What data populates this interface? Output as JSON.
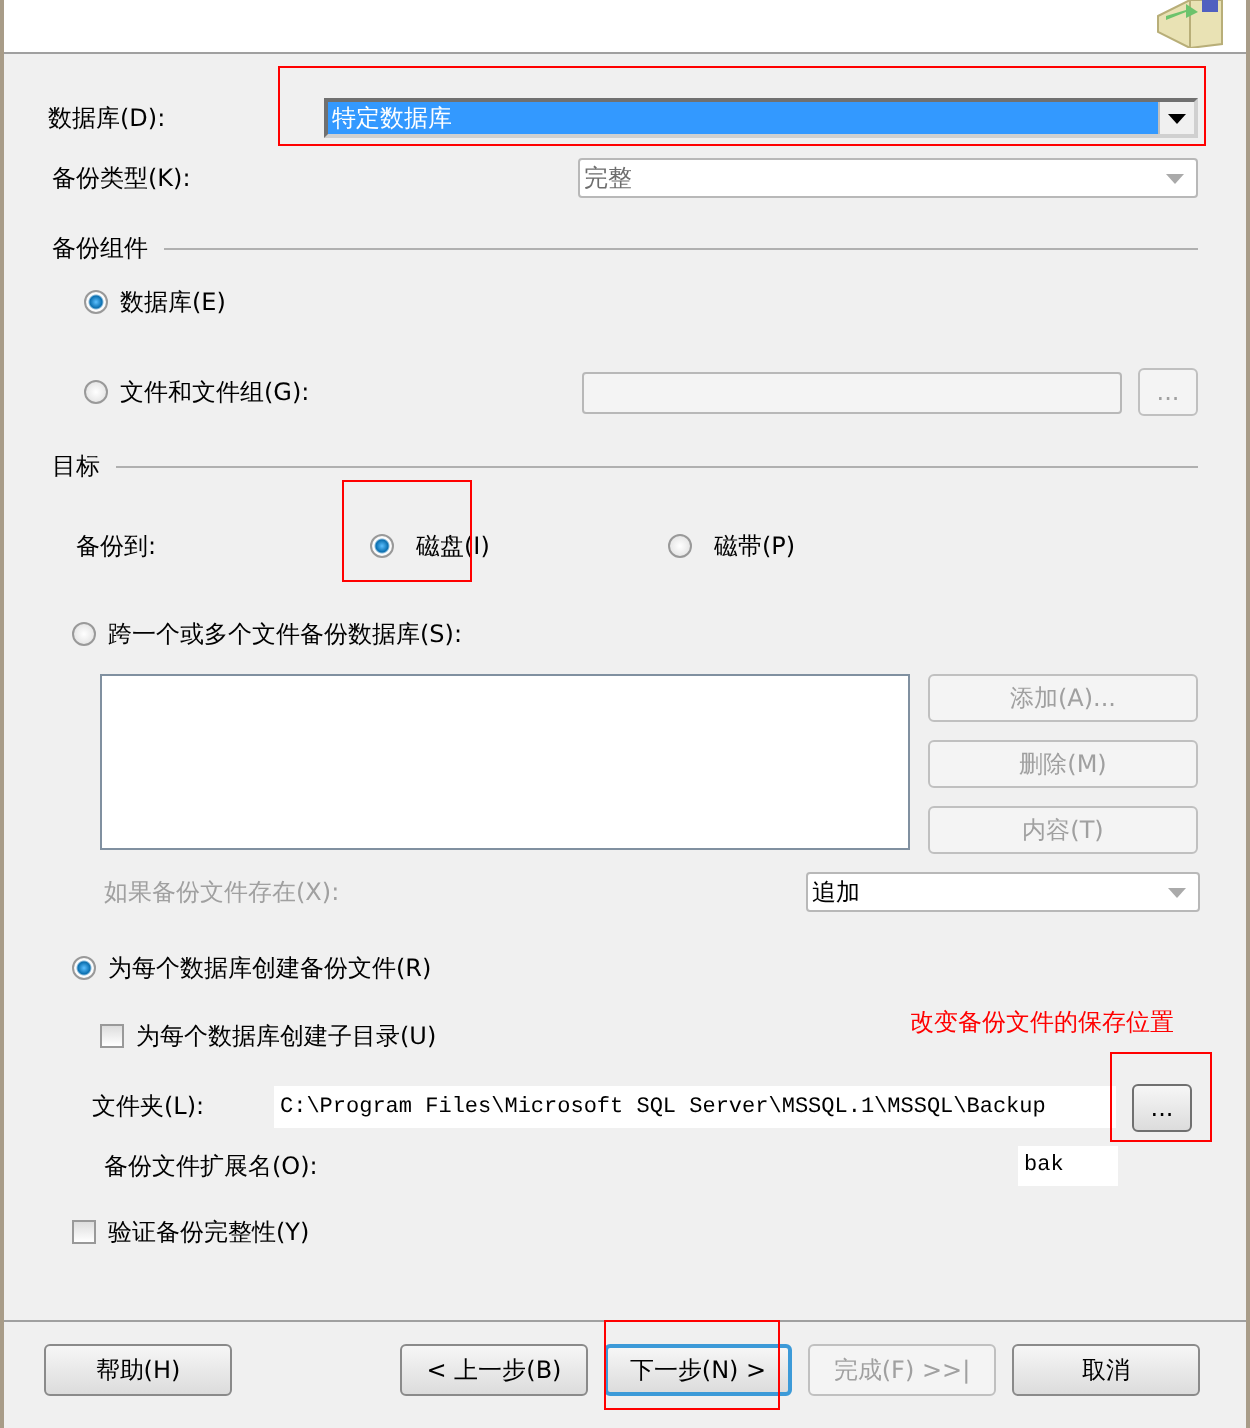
{
  "database": {
    "label": "数据库(D):",
    "value": "特定数据库",
    "highlighted": true
  },
  "backup_type": {
    "label": "备份类型(K):",
    "value": "完整",
    "disabled": true
  },
  "backup_component": {
    "title": "备份组件",
    "options": [
      {
        "label": "数据库(E)",
        "selected": true
      },
      {
        "label": "文件和文件组(G):",
        "selected": false
      }
    ],
    "browse_button": {
      "label": "...",
      "disabled": true
    }
  },
  "destination": {
    "title": "目标",
    "backup_to_label": "备份到:",
    "media": [
      {
        "label": "磁盘(I)",
        "selected": true
      },
      {
        "label": "磁带(P)",
        "selected": false
      }
    ],
    "modes": [
      {
        "label": "跨一个或多个文件备份数据库(S):",
        "selected": false
      },
      {
        "label": "为每个数据库创建备份文件(R)",
        "selected": true
      }
    ],
    "file_buttons": [
      {
        "label": "添加(A)...",
        "disabled": true
      },
      {
        "label": "删除(M)",
        "disabled": true
      },
      {
        "label": "内容(T)",
        "disabled": true
      }
    ],
    "if_exists": {
      "label": "如果备份文件存在(X):",
      "value": "追加",
      "disabled": true
    },
    "subdirectory": {
      "label": "为每个数据库创建子目录(U)",
      "checked": false
    },
    "annotation": "改变备份文件的保存位置",
    "folder": {
      "label": "文件夹(L):",
      "value": "C:\\Program Files\\Microsoft SQL Server\\MSSQL.1\\MSSQL\\Backup",
      "browse_button": "..."
    },
    "extension": {
      "label": "备份文件扩展名(O):",
      "value": "bak"
    }
  },
  "verify": {
    "label": "验证备份完整性(Y)",
    "checked": false
  },
  "buttons": [
    {
      "label": "帮助(H)",
      "disabled": false,
      "focused": false
    },
    {
      "label": "< 上一步(B)",
      "disabled": false,
      "focused": false
    },
    {
      "label": "下一步(N) >",
      "disabled": false,
      "focused": true
    },
    {
      "label": "完成(F) >>|",
      "disabled": true,
      "focused": false
    },
    {
      "label": "取消",
      "disabled": false,
      "focused": false
    }
  ]
}
